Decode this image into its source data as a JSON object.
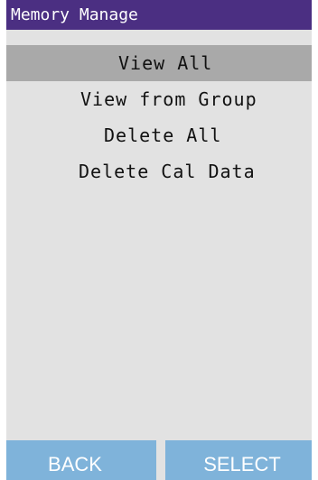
{
  "title": "Memory Manage",
  "menu": {
    "items": [
      {
        "label": "View All",
        "selected": true
      },
      {
        "label": "View from Group",
        "selected": false
      },
      {
        "label": "Delete All",
        "selected": false
      },
      {
        "label": "Delete Cal Data",
        "selected": false
      }
    ]
  },
  "softkeys": {
    "left": "BACK",
    "right": "SELECT"
  },
  "colors": {
    "titlebar": "#4b2f82",
    "background": "#e2e2e2",
    "selection": "#a9a9a9",
    "softkey": "#7fb3da"
  }
}
